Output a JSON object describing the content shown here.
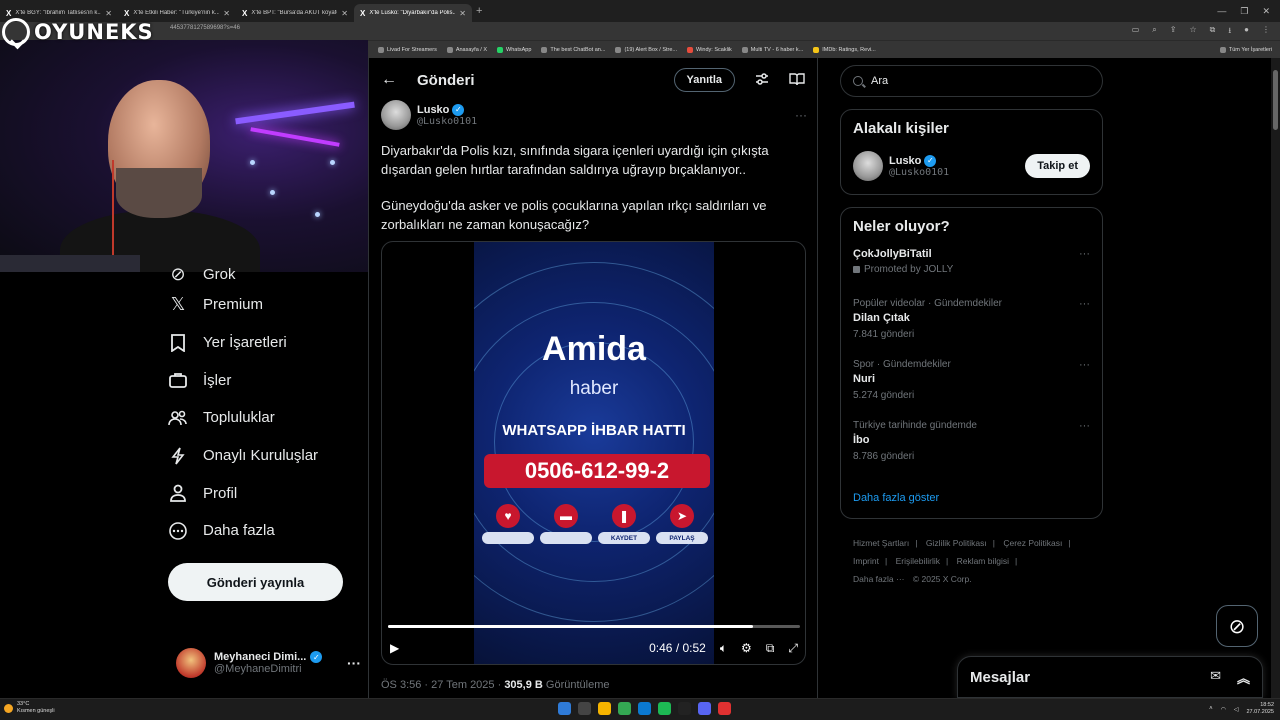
{
  "browser": {
    "tabs": [
      {
        "label": "X'te BGY: \"İbrahim Tatlıses'in k...",
        "active": false
      },
      {
        "label": "X'te Etkili Haber: \"Türkiye'nin k...",
        "active": false
      },
      {
        "label": "X'te BPT: \"Bursa'da AKUT koyafe...",
        "active": false
      },
      {
        "label": "X'te Lusko: \"Diyarbakır'da Polis...",
        "active": true
      }
    ],
    "new_tab": "+",
    "url": "4453778127589698?s=46",
    "bookmarks": [
      "Livad For Streamers",
      "Anasayfa / X",
      "WhatsApp",
      "The best ChatBot an...",
      "(19) Alert Box / Stre...",
      "Windy: Scaklik",
      "Multi TV - 6 haber k...",
      "IMDb: Ratings, Revi..."
    ],
    "bookmarks_folder": "Tüm Yer İşaretleri"
  },
  "overlay": {
    "logo_text": "OYUNEKS"
  },
  "nav": {
    "items": [
      {
        "label": "Grok",
        "icon": "grok-icon"
      },
      {
        "label": "Premium",
        "icon": "x-logo-icon"
      },
      {
        "label": "Yer İşaretleri",
        "icon": "bookmark-icon"
      },
      {
        "label": "İşler",
        "icon": "briefcase-icon"
      },
      {
        "label": "Topluluklar",
        "icon": "communities-icon"
      },
      {
        "label": "Onaylı Kuruluşlar",
        "icon": "lightning-icon"
      },
      {
        "label": "Profil",
        "icon": "person-icon"
      },
      {
        "label": "Daha fazla",
        "icon": "more-circle-icon"
      }
    ],
    "post_button": "Gönderi yayınla",
    "account": {
      "name": "Meyhaneci Dimi...",
      "handle": "@MeyhaneDimitri"
    }
  },
  "main": {
    "title": "Gönderi",
    "reply_button": "Yanıtla",
    "tweet": {
      "author_name": "Lusko",
      "author_handle": "@Lusko0101",
      "paragraph1": "Diyarbakır'da Polis kızı, sınıfında sigara içenleri uyardığı için çıkışta dışardan gelen hırtlar tarafından saldırıya uğrayıp bıçaklanıyor..",
      "paragraph2": "Güneydoğu'da asker ve polis çocuklarına yapılan ırkçı saldırıları ve zorbalıkları ne zaman konuşacağız?",
      "video": {
        "brand": "Amida",
        "brand_sub": "haber",
        "hotline": "WHATSAPP İHBAR HATTI",
        "phone": "0506-612-99-2",
        "save_label": "KAYDET",
        "share_label": "PAYLAŞ",
        "time": "0:46 / 0:52",
        "progress": 0.885
      },
      "timestamp": "ÖS 3:56 · 27 Tem 2025 · ",
      "views_count": "305,9 B",
      "views_label": " Görüntüleme"
    }
  },
  "sidebar": {
    "search_placeholder": "Ara",
    "related_title": "Alakalı kişiler",
    "related": {
      "name": "Lusko",
      "handle": "@Lusko0101",
      "follow_label": "Takip et"
    },
    "trends_title": "Neler oluyor?",
    "promoted": {
      "name": "ÇokJollyBiTatil",
      "label": "Promoted by JOLLY"
    },
    "trends": [
      {
        "meta": "Popüler videolar · Gündemdekiler",
        "name": "Dilan Çıtak",
        "count": "7.841 gönderi"
      },
      {
        "meta": "Spor · Gündemdekiler",
        "name": "Nuri",
        "count": "5.274 gönderi"
      },
      {
        "meta": "Türkiye tarihinde gündemde",
        "name": "İbo",
        "count": "8.786 gönderi"
      }
    ],
    "show_more": "Daha fazla göster",
    "footer": {
      "links": [
        "Hizmet Şartları",
        "Gizlilik Politikası",
        "Çerez Politikası",
        "Imprint",
        "Erişilebilirlik",
        "Reklam bilgisi"
      ],
      "more": "Daha fazla ···",
      "copyright": "© 2025 X Corp."
    },
    "messages_title": "Mesajlar"
  },
  "taskbar": {
    "weather_temp": "33°C",
    "weather_desc": "Kısmen güneşli",
    "time": "18:52",
    "date": "27.07.2025"
  },
  "colors": {
    "accent": "#1d9bf0",
    "background": "#000000",
    "border": "#2f3336",
    "muted_text": "#71767b",
    "video_red": "#c8172e"
  }
}
